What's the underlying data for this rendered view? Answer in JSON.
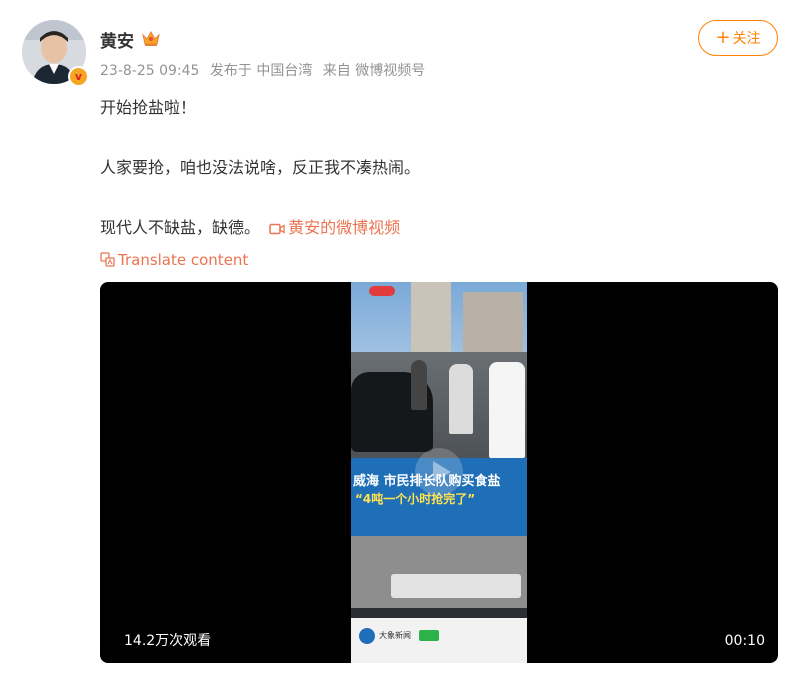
{
  "post": {
    "author": "黄安",
    "timestamp": "23-8-25 09:45",
    "location": "发布于 中国台湾",
    "source": "来自 微博视频号",
    "follow_label": "关注",
    "lines": [
      "开始抢盐啦！",
      "人家要抢，咱也没法说啥，反正我不凑热闹。",
      "现代人不缺盐，缺德。"
    ],
    "video_link_label": "黄安的微博视频",
    "translate_label": "Translate content"
  },
  "video": {
    "views": "14.2万次观看",
    "duration": "00:10",
    "caption_line1": "威海 市民排长队购买食盐",
    "caption_line2": "“4吨一个小时抢完了”",
    "bottom_source": "大象新闻"
  },
  "icons": {
    "avatar": "avatar-photo",
    "verified": "verified-badge-icon",
    "crown": "crown-icon",
    "plus": "plus-icon",
    "video": "video-camera-icon",
    "translate": "translate-icon",
    "play": "play-icon"
  },
  "colors": {
    "accent": "#ff8200",
    "link": "#eb7350",
    "meta": "#939393",
    "verified": "#f5a623"
  }
}
